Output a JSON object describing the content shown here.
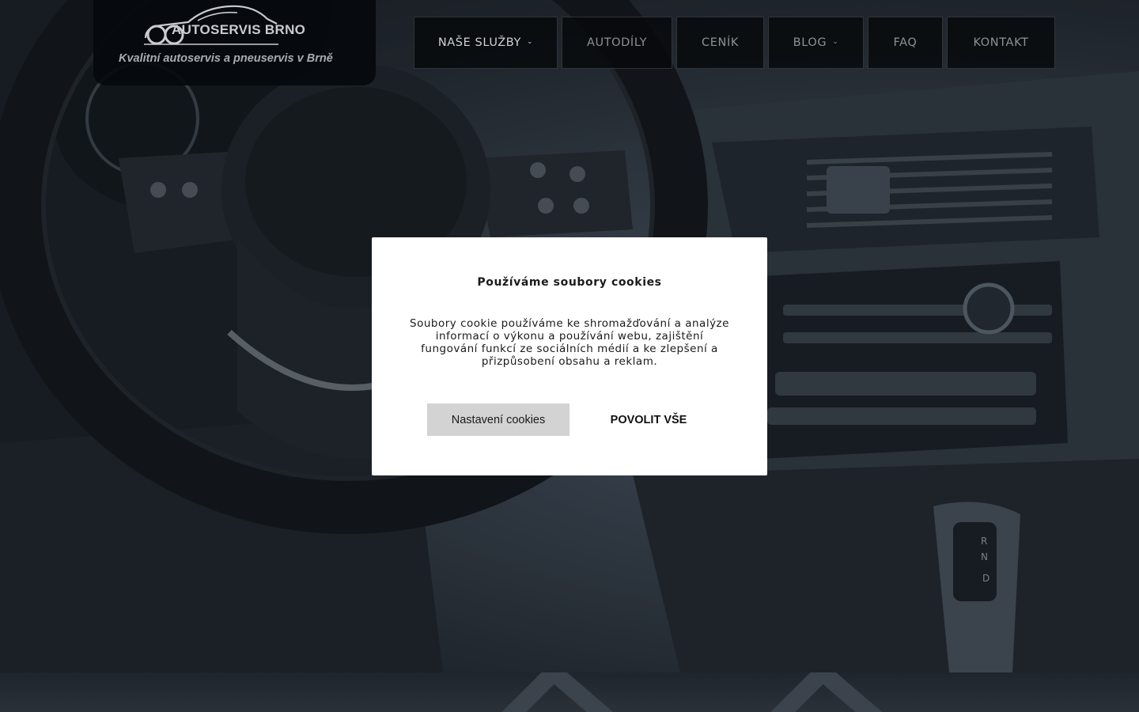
{
  "logo": {
    "title": "AUTOSERVIS BRNO",
    "tagline": "Kvalitní autoservis a pneuservis v Brně",
    "icon": "car-logo-icon"
  },
  "nav": {
    "items": [
      {
        "label": "NAŠE SLUŽBY",
        "has_dropdown": true
      },
      {
        "label": "AUTODÍLY",
        "has_dropdown": false
      },
      {
        "label": "CENÍK",
        "has_dropdown": false
      },
      {
        "label": "BLOG",
        "has_dropdown": true
      },
      {
        "label": "FAQ",
        "has_dropdown": false
      },
      {
        "label": "KONTAKT",
        "has_dropdown": false
      }
    ],
    "dropdown_icon": "chevron-down-icon"
  },
  "cookie_modal": {
    "title": "Používáme soubory cookies",
    "text": "Soubory cookie používáme ke shromažďování a analýze informací o výkonu a používání webu, zajištění fungování funkcí ze sociálních médií a ke zlepšení a přizpůsobení obsahu a reklam.",
    "settings_button": "Nastavení cookies",
    "allow_all_button": "POVOLIT VŠE"
  },
  "colors": {
    "overlay": "#0c1016",
    "modal_bg": "#ffffff",
    "settings_button_bg": "#d3d3d3",
    "nav_bg": "#06080b"
  }
}
